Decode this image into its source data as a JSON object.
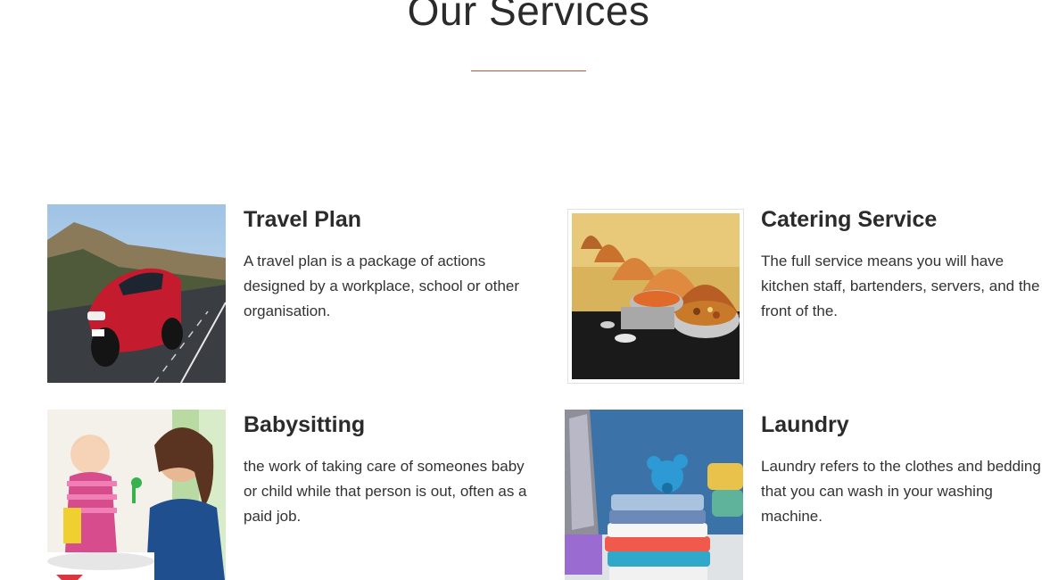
{
  "section": {
    "title": "Our Services",
    "accent_color": "#d9482f"
  },
  "services": [
    {
      "title": "Travel Plan",
      "description": "A travel plan is a package of actions designed by a workplace, school or other organisation.",
      "image_icon": "red-sports-car-photo"
    },
    {
      "title": "Catering Service",
      "description": "The full service means you will have kitchen staff, bartenders, servers, and the front of the.",
      "image_icon": "buffet-chafing-dishes-photo"
    },
    {
      "title": "Babysitting",
      "description": "the work of taking care of someones baby or child while that person is out, often as a paid job.",
      "image_icon": "mother-and-baby-photo"
    },
    {
      "title": "Laundry",
      "description": "Laundry refers to the clothes and bedding that you can wash in your washing machine.",
      "image_icon": "folded-clothes-and-iron-photo"
    }
  ]
}
